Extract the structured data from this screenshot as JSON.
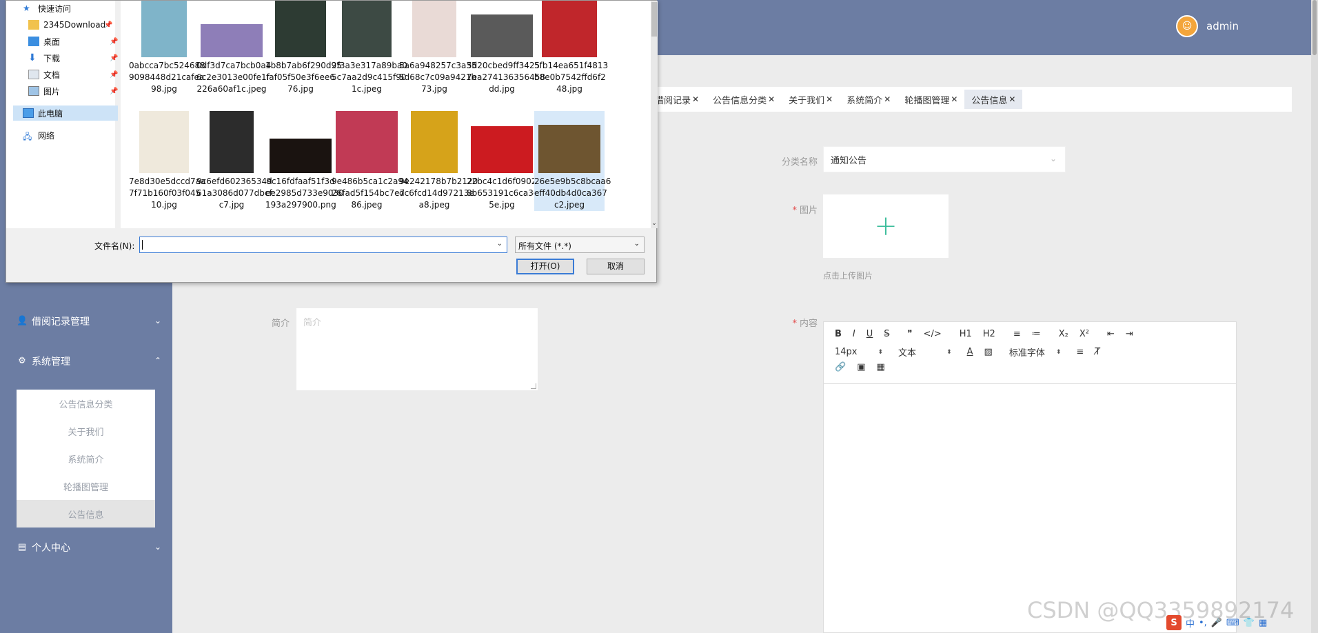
{
  "header": {
    "username": "admin"
  },
  "sidebar": {
    "items": [
      {
        "label": "借阅记录管理",
        "icon": "user-icon"
      },
      {
        "label": "系统管理",
        "icon": "settings-icon"
      },
      {
        "label": "个人中心",
        "icon": "calendar-icon"
      }
    ],
    "submenu": [
      "公告信息分类",
      "关于我们",
      "系统简介",
      "轮播图管理",
      "公告信息"
    ]
  },
  "tags": [
    "借阅记录",
    "公告信息分类",
    "关于我们",
    "系统简介",
    "轮播图管理",
    "公告信息"
  ],
  "form": {
    "category_label": "分类名称",
    "category_value": "通知公告",
    "image_label": "图片",
    "upload_hint": "点击上传图片",
    "intro_label": "简介",
    "intro_placeholder": "简介",
    "content_label": "内容",
    "editor": {
      "row1": [
        "B",
        "I",
        "U",
        "S",
        "❞",
        "</>",
        "H1",
        "H2",
        "≡",
        "≔",
        "X₂",
        "X²",
        "⇤",
        "⇥"
      ],
      "font_size": "14px",
      "text_type": "文本",
      "font_family": "标准字体"
    }
  },
  "dialog": {
    "nav": [
      {
        "label": "快速访问",
        "pinned": false
      },
      {
        "label": "2345Download",
        "pinned": true
      },
      {
        "label": "桌面",
        "pinned": true
      },
      {
        "label": "下载",
        "pinned": true
      },
      {
        "label": "文档",
        "pinned": true
      },
      {
        "label": "图片",
        "pinned": true
      },
      {
        "label": "此电脑",
        "pinned": false
      },
      {
        "label": "网络",
        "pinned": false
      }
    ],
    "files_row1": [
      {
        "name": "0abcca7bc5246889098448d21cafea98.jpg",
        "color": "#7fb4c9"
      },
      {
        "name": "0df3d7ca7bcb0a46c2e3013e00fe1f226a60af1c.jpeg",
        "color": "#8e7eb8"
      },
      {
        "name": "1b8b7ab6f290d95faf05f50e3f6ee676.jpg",
        "color": "#2d3b33"
      },
      {
        "name": "2f3a3e317a89ba05c7aa2d9c415f901c.jpeg",
        "color": "#3d4a44"
      },
      {
        "name": "5a6a948257c3a355d68c7c09a9421b73.jpg",
        "color": "#e9dad6"
      },
      {
        "name": "5d20cbed9ff34257ea274136356458dd.jpg",
        "color": "#5a5a5a"
      },
      {
        "name": "5fb14ea651f4813b8e0b7542ffd6f248.jpg",
        "color": "#c0262b"
      }
    ],
    "files_row2": [
      {
        "name": "7e8d30e5dccd7aa7f71b160f03f04510.jpg",
        "color": "#efe9dc"
      },
      {
        "name": "9c6efd60236534d61a3086d077dbcfc7.jpg",
        "color": "#2c2c2c"
      },
      {
        "name": "9c16fdfaaf51f3dee2985d733e9030193a297900.png",
        "color": "#1a1310"
      },
      {
        "name": "9e486b5ca1c2a9426fad5f154bc7e786.jpeg",
        "color": "#c13a55"
      },
      {
        "name": "9e242178b7b2120dc6fcd14d97213ea8.jpeg",
        "color": "#d6a31a"
      },
      {
        "name": "22bc4c1d6f090258b653191c6ca3d25e.jpg",
        "color": "#cc1b20"
      },
      {
        "name": "26e5e9b5c8bcaa6eff40db4d0ca367c2.jpeg",
        "color": "#6e5530"
      }
    ],
    "filename_label": "文件名(N):",
    "filetype": "所有文件 (*.*)",
    "open_button": "打开(O)",
    "cancel_button": "取消"
  },
  "watermark": "CSDN @QQ3359892174",
  "tray": {
    "ime": "中"
  }
}
